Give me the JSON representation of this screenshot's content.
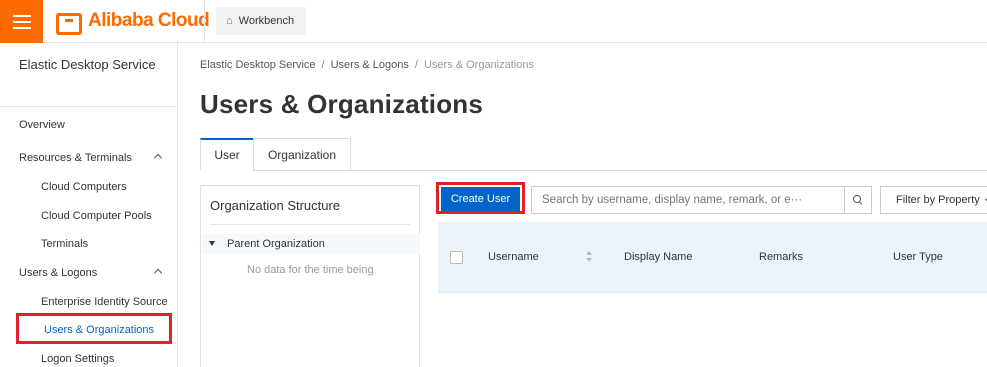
{
  "header": {
    "brand": "Alibaba Cloud",
    "workbench_label": "Workbench"
  },
  "sidebar": {
    "title": "Elastic Desktop Service",
    "overview": "Overview",
    "groups": [
      {
        "label": "Resources & Terminals",
        "items": [
          "Cloud Computers",
          "Cloud Computer Pools",
          "Terminals"
        ]
      },
      {
        "label": "Users & Logons",
        "items": [
          "Enterprise Identity Source",
          "Users & Organizations",
          "Logon Settings"
        ]
      }
    ],
    "active_item": "Users & Organizations"
  },
  "breadcrumb": [
    "Elastic Desktop Service",
    "Users & Logons",
    "Users & Organizations"
  ],
  "page_title": "Users & Organizations",
  "tabs": [
    {
      "label": "User",
      "active": true
    },
    {
      "label": "Organization",
      "active": false
    }
  ],
  "org_panel": {
    "title": "Organization Structure",
    "root": "Parent Organization",
    "empty_text": "No data for the time being"
  },
  "toolbar": {
    "create_label": "Create User",
    "search_placeholder": "Search by username, display name, remark, or e···",
    "filter_label": "Filter by Property"
  },
  "table": {
    "columns": [
      "Username",
      "Display Name",
      "Remarks",
      "User Type"
    ]
  },
  "colors": {
    "brand_orange": "#ff6a00",
    "primary_blue": "#0064c8",
    "highlight_red": "#e0202a",
    "table_header_bg": "#ebf3fb"
  },
  "icons": [
    "menu-icon",
    "alibaba-cloud-logo",
    "home-icon",
    "chevron-up-icon",
    "caret-down-icon",
    "search-icon",
    "chevron-down-icon",
    "sort-icon"
  ]
}
